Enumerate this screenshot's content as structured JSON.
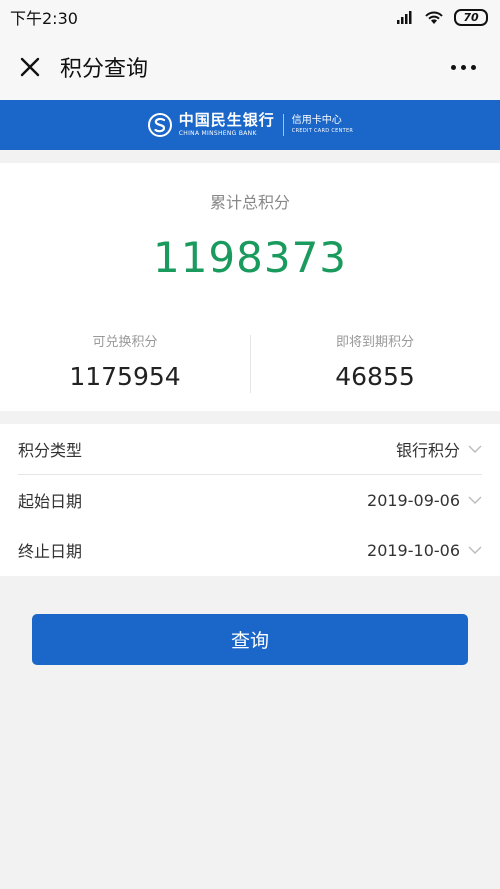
{
  "status_bar": {
    "time": "下午2:30",
    "battery": "70",
    "icons": [
      "signal-icon",
      "wifi-icon",
      "battery-icon"
    ]
  },
  "nav": {
    "title": "积分查询",
    "close_icon": "close-icon",
    "more_icon": "more-icon"
  },
  "banner": {
    "bank_name_cn": "中国民生银行",
    "bank_name_en": "CHINA MINSHENG BANK",
    "center_cn": "信用卡中心",
    "center_en": "CREDIT CARD CENTER",
    "background_color": "#1a66c9"
  },
  "points": {
    "total_label": "累计总积分",
    "total_value": "1198373",
    "total_color": "#1a9a5c",
    "redeemable_label": "可兑换积分",
    "redeemable_value": "1175954",
    "expiring_label": "即将到期积分",
    "expiring_value": "46855"
  },
  "form": {
    "type_label": "积分类型",
    "type_value": "银行积分",
    "start_label": "起始日期",
    "start_value": "2019-09-06",
    "end_label": "终止日期",
    "end_value": "2019-10-06"
  },
  "query_button": {
    "label": "查询",
    "color": "#1a66c9"
  }
}
